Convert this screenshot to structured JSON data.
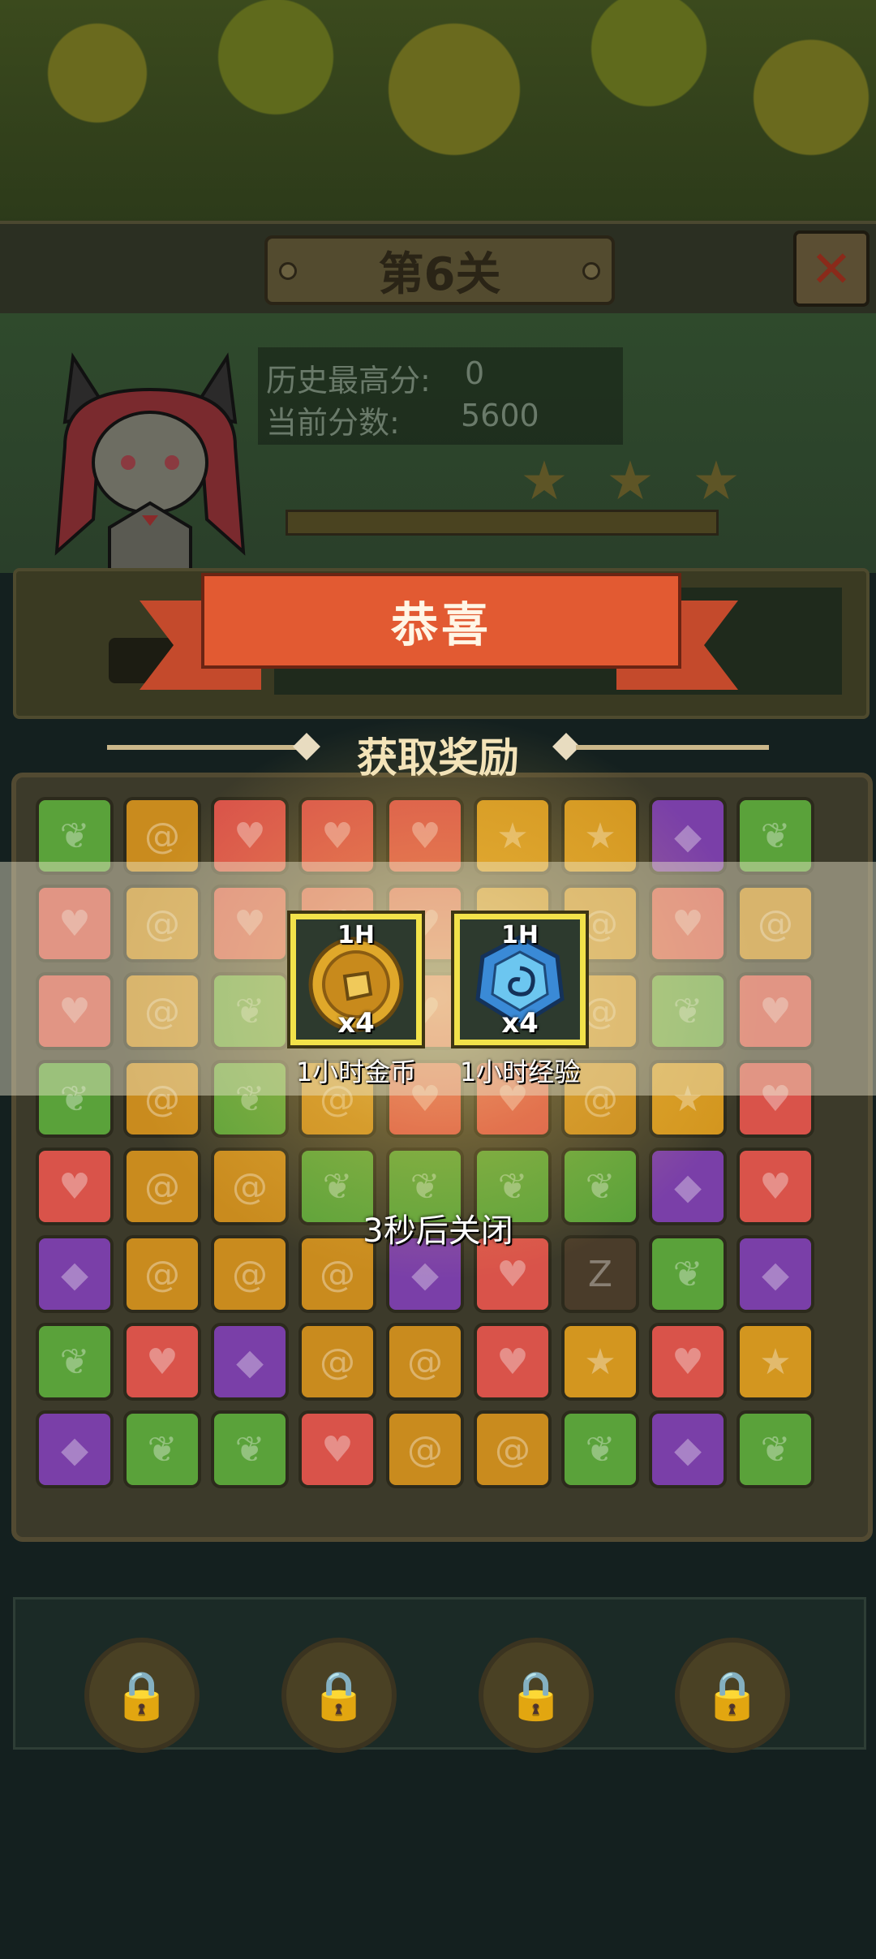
{
  "level": {
    "title": "第6关",
    "close_symbol": "✕"
  },
  "score": {
    "best_label": "历史最高分:",
    "best_value": "0",
    "current_label": "当前分数:",
    "current_value": "5600",
    "stars_total": 3,
    "progress_fraction": 1.0
  },
  "banner": {
    "title": "恭喜"
  },
  "rewards_section": {
    "heading": "获取奖励",
    "items": [
      {
        "badge": "1H",
        "count": "x4",
        "label": "1小时金币",
        "icon": "gold-coin-icon"
      },
      {
        "badge": "1H",
        "count": "x4",
        "label": "1小时经验",
        "icon": "blue-exp-gem-icon"
      }
    ]
  },
  "countdown": "3秒后关闭",
  "board": {
    "rows": [
      [
        "leaf",
        "swirl",
        "heart",
        "heart",
        "heart",
        "star",
        "star",
        "gem",
        "leaf"
      ],
      [
        "heart",
        "swirl",
        "heart",
        "heart",
        "heart",
        "swirl",
        "swirl",
        "heart",
        "swirl"
      ],
      [
        "heart",
        "swirl",
        "leaf",
        "swirl",
        "heart",
        "heart",
        "swirl",
        "leaf",
        "heart"
      ],
      [
        "leaf",
        "swirl",
        "leaf",
        "swirl",
        "heart",
        "heart",
        "swirl",
        "star",
        "heart"
      ],
      [
        "heart",
        "swirl",
        "swirl",
        "leaf",
        "leaf",
        "leaf",
        "leaf",
        "gem",
        "heart"
      ],
      [
        "gem",
        "swirl",
        "swirl",
        "swirl",
        "gem",
        "heart",
        "bomb",
        "leaf",
        "gem"
      ],
      [
        "leaf",
        "heart",
        "gem",
        "swirl",
        "swirl",
        "heart",
        "star",
        "heart",
        "star"
      ],
      [
        "gem",
        "leaf",
        "leaf",
        "heart",
        "swirl",
        "swirl",
        "leaf",
        "gem",
        "leaf"
      ]
    ],
    "colors": {
      "leaf": "#5aa23a",
      "swirl": "#c98b1e",
      "heart": "#d9534a",
      "gem": "#7a3fa8",
      "star": "#d3961f",
      "bomb": "#4a3c2a"
    },
    "glyphs": {
      "leaf": "❦",
      "swirl": "@",
      "heart": "♥",
      "gem": "◆",
      "star": "★",
      "bomb": "Z"
    }
  },
  "tools": [
    {
      "name": "locked-tool-1",
      "icon": "lock-icon"
    },
    {
      "name": "locked-tool-2",
      "icon": "lock-icon"
    },
    {
      "name": "locked-tool-3",
      "icon": "lock-icon"
    },
    {
      "name": "locked-tool-4",
      "icon": "lock-icon"
    }
  ]
}
